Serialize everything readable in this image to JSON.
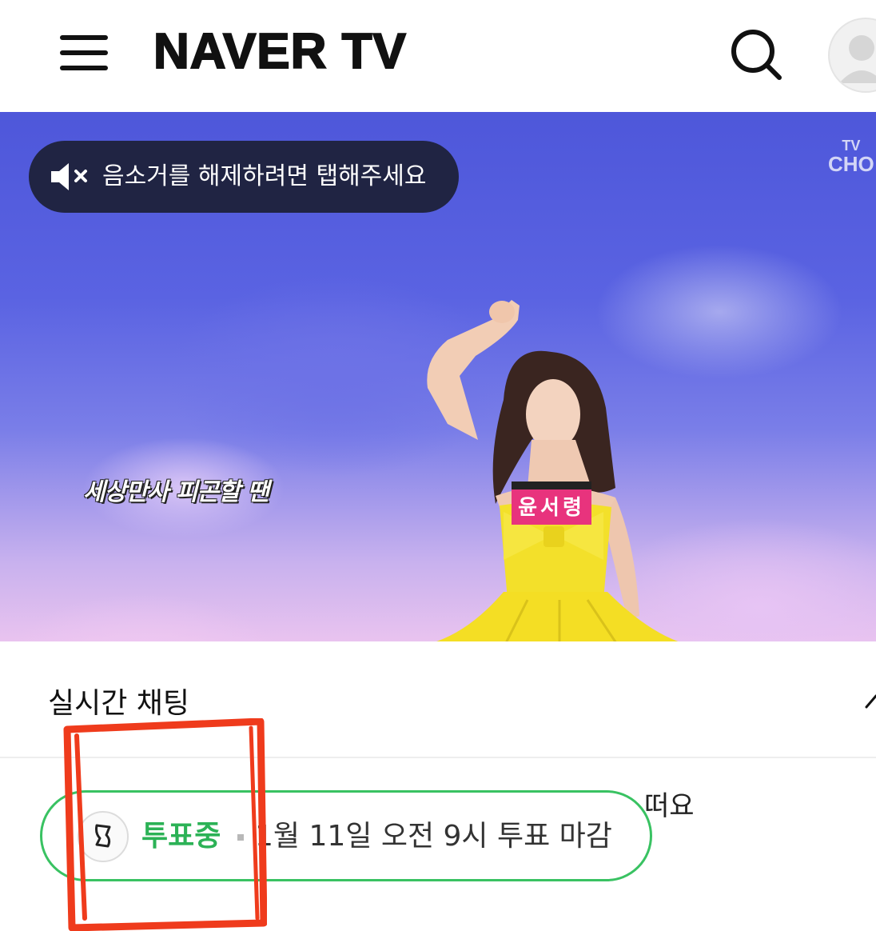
{
  "header": {
    "logo": "NAVER TV"
  },
  "video": {
    "mute_hint": "음소거를 해제하려면 탭해주세요",
    "channel_badge_top": "TV",
    "channel_badge_bottom": "CHO",
    "subtitle": "세상만사 피곤할 땐",
    "name_tag": "윤서령"
  },
  "chat": {
    "title": "실시간 채팅",
    "partial_message_1": "떠요"
  },
  "vote": {
    "status": "투표중",
    "deadline": "1월 11일 오전 9시 투표 마감"
  },
  "colors": {
    "accent_green": "#2cb256",
    "annotation_red": "#ef3b1c"
  }
}
